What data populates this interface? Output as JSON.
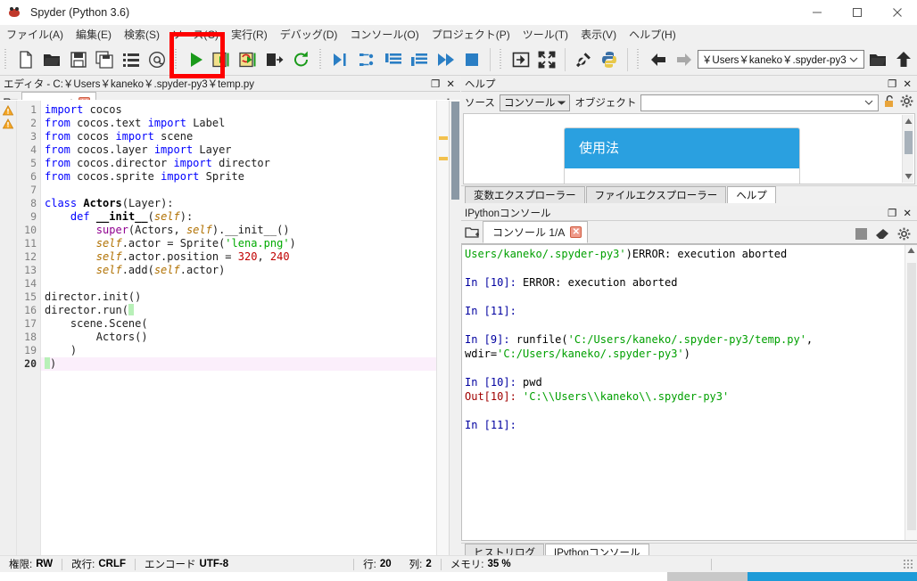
{
  "window": {
    "title": "Spyder (Python 3.6)",
    "icon": "spyder-icon",
    "minimize_label": "—",
    "maximize_label": "□",
    "close_label": "✕"
  },
  "menubar": {
    "items": [
      {
        "label": "ファイル(A)",
        "name": "menu-file"
      },
      {
        "label": "編集(E)",
        "name": "menu-edit"
      },
      {
        "label": "検索(S)",
        "name": "menu-search"
      },
      {
        "label": "ソース(C)",
        "name": "menu-source"
      },
      {
        "label": "実行(R)",
        "name": "menu-run"
      },
      {
        "label": "デバッグ(D)",
        "name": "menu-debug"
      },
      {
        "label": "コンソール(O)",
        "name": "menu-console"
      },
      {
        "label": "プロジェクト(P)",
        "name": "menu-project"
      },
      {
        "label": "ツール(T)",
        "name": "menu-tools"
      },
      {
        "label": "表示(V)",
        "name": "menu-view"
      },
      {
        "label": "ヘルプ(H)",
        "name": "menu-help"
      }
    ]
  },
  "toolbar": {
    "buttons": [
      {
        "name": "new-file-icon",
        "tip": "New file"
      },
      {
        "name": "open-file-icon",
        "tip": "Open file"
      },
      {
        "name": "save-file-icon",
        "tip": "Save file"
      },
      {
        "name": "save-all-icon",
        "tip": "Save all"
      },
      {
        "name": "file-switcher-icon",
        "tip": "File switcher"
      },
      {
        "name": "find-in-files-icon",
        "tip": "Find in files"
      },
      {
        "name": "run-file-icon",
        "tip": "Run file"
      },
      {
        "name": "run-cell-icon",
        "tip": "Run current cell"
      },
      {
        "name": "run-cell-advance-icon",
        "tip": "Run cell and advance"
      },
      {
        "name": "run-selection-icon",
        "tip": "Run selection"
      },
      {
        "name": "rerun-icon",
        "tip": "Re-run last script"
      },
      {
        "name": "debug-file-icon",
        "tip": "Debug file"
      },
      {
        "name": "step-over-icon",
        "tip": "Step over"
      },
      {
        "name": "step-into-icon",
        "tip": "Step into"
      },
      {
        "name": "step-return-icon",
        "tip": "Step return"
      },
      {
        "name": "continue-icon",
        "tip": "Continue"
      },
      {
        "name": "stop-debug-icon",
        "tip": "Stop debugging"
      },
      {
        "name": "maximize-pane-icon",
        "tip": "Maximize current pane"
      },
      {
        "name": "fullscreen-icon",
        "tip": "Fullscreen mode"
      },
      {
        "name": "preferences-icon",
        "tip": "Preferences"
      },
      {
        "name": "pythonpath-icon",
        "tip": "PYTHONPATH manager"
      },
      {
        "name": "back-icon",
        "tip": "Back"
      },
      {
        "name": "forward-icon",
        "tip": "Forward"
      },
      {
        "name": "browse-dir-icon",
        "tip": "Browse a working directory"
      },
      {
        "name": "parent-dir-icon",
        "tip": "Change to parent directory"
      }
    ],
    "path_value": "￥Users￥kaneko￥.spyder-py3"
  },
  "editor": {
    "panel_title": "エディタ - C:￥Users￥kaneko￥.spyder-py3￥temp.py",
    "tab_label": "temp.py*",
    "close_glyph": "✕",
    "options_icon": "gear-icon",
    "browse_icon": "browse-tabs-icon",
    "undock_glyph": "❐",
    "close_pane_glyph": "✕",
    "cursor_line": 20,
    "lines": [
      {
        "n": 1,
        "warn": true,
        "html": "<span class=\"k\">import</span> cocos"
      },
      {
        "n": 2,
        "warn": true,
        "html": "<span class=\"k\">from</span> cocos.text <span class=\"k\">import</span> Label"
      },
      {
        "n": 3,
        "warn": false,
        "html": "<span class=\"k\">from</span> cocos <span class=\"k\">import</span> scene"
      },
      {
        "n": 4,
        "warn": false,
        "html": "<span class=\"k\">from</span> cocos.layer <span class=\"k\">import</span> Layer"
      },
      {
        "n": 5,
        "warn": false,
        "html": "<span class=\"k\">from</span> cocos.director <span class=\"k\">import</span> director"
      },
      {
        "n": 6,
        "warn": false,
        "html": "<span class=\"k\">from</span> cocos.sprite <span class=\"k\">import</span> Sprite"
      },
      {
        "n": 7,
        "warn": false,
        "html": ""
      },
      {
        "n": 8,
        "warn": false,
        "html": "<span class=\"k\">class</span> <span class=\"df\">Actors</span>(Layer):"
      },
      {
        "n": 9,
        "warn": false,
        "html": "    <span class=\"k\">def</span> <span class=\"df\">__init__</span>(<span class=\"cn\">self</span>):"
      },
      {
        "n": 10,
        "warn": false,
        "html": "        <span class=\"bi\">super</span>(Actors, <span class=\"cn\">self</span>).__init__()"
      },
      {
        "n": 11,
        "warn": false,
        "html": "        <span class=\"cn\">self</span>.actor = Sprite(<span class=\"st\">'lena.png'</span>)"
      },
      {
        "n": 12,
        "warn": false,
        "html": "        <span class=\"cn\">self</span>.actor.position = <span class=\"nm\">320</span>, <span class=\"nm\">240</span>"
      },
      {
        "n": 13,
        "warn": false,
        "html": "        <span class=\"cn\">self</span>.add(<span class=\"cn\">self</span>.actor)"
      },
      {
        "n": 14,
        "warn": false,
        "html": ""
      },
      {
        "n": 15,
        "warn": false,
        "html": "director.init()"
      },
      {
        "n": 16,
        "warn": false,
        "html": "director.run(<span class=\"cursor-block\"></span>"
      },
      {
        "n": 17,
        "warn": false,
        "html": "    scene.Scene("
      },
      {
        "n": 18,
        "warn": false,
        "html": "        Actors()"
      },
      {
        "n": 19,
        "warn": false,
        "html": "    )"
      },
      {
        "n": 20,
        "warn": false,
        "html": "<span class=\"cursor-block\"></span>)"
      }
    ]
  },
  "help": {
    "panel_title": "ヘルプ",
    "source_label": "ソース",
    "source_value": "コンソール",
    "object_label": "オブジェクト",
    "object_value": "",
    "lock_icon": "unlock-icon",
    "options_icon": "gear-icon",
    "card_title": "使用法",
    "card_accent": "#2aa0e0",
    "undock_glyph": "❐",
    "close_pane_glyph": "✕",
    "tabs": [
      {
        "label": "変数エクスプローラー",
        "name": "tab-variable-explorer",
        "active": false
      },
      {
        "label": "ファイルエクスプローラー",
        "name": "tab-file-explorer",
        "active": false
      },
      {
        "label": "ヘルプ",
        "name": "tab-help",
        "active": true
      }
    ]
  },
  "console": {
    "panel_title": "IPythonコンソール",
    "tab_label": "コンソール 1/A",
    "close_glyph": "✕",
    "browse_icon": "browse-tabs-icon",
    "stop_icon": "stop-icon",
    "clear_icon": "eraser-icon",
    "options_icon": "gear-icon",
    "undock_glyph": "❐",
    "close_pane_glyph": "✕",
    "output_html": "<span class=\"cstr\">Users/kaneko/.spyder-py3'</span>)ERROR: execution aborted\n\n<span class=\"cin\">In [10]:</span> ERROR: execution aborted\n\n<span class=\"cin\">In [11]:</span>\n\n<span class=\"cin\">In [9]:</span> runfile(<span class=\"cstr\">'C:/Users/kaneko/.spyder-py3/temp.py'</span>, wdir=<span class=\"cstr\">'C:/Users/kaneko/.spyder-py3'</span>)\n\n<span class=\"cin\">In [10]:</span> pwd\n<span class=\"cout\">Out[10]:</span> <span class=\"cstr\">'C:\\\\Users\\\\kaneko\\\\.spyder-py3'</span>\n\n<span class=\"cin\">In [11]:</span>",
    "tabs": [
      {
        "label": "ヒストリログ",
        "name": "tab-history-log",
        "active": false
      },
      {
        "label": "IPythonコンソール",
        "name": "tab-ipython-console",
        "active": true
      }
    ]
  },
  "statusbar": {
    "items": [
      {
        "label": "権限:",
        "value": "RW",
        "name": "status-permissions"
      },
      {
        "label": "改行:",
        "value": "CRLF",
        "name": "status-eol"
      },
      {
        "label": "エンコード",
        "value": "UTF-8",
        "name": "status-encoding"
      },
      {
        "label": "行:",
        "value": "20",
        "name": "status-line"
      },
      {
        "label": "列:",
        "value": "2",
        "name": "status-column"
      },
      {
        "label": "メモリ:",
        "value": "35 %",
        "name": "status-memory"
      }
    ]
  },
  "annotation": {
    "color": "#fe0000",
    "target": "run-file-icon"
  }
}
